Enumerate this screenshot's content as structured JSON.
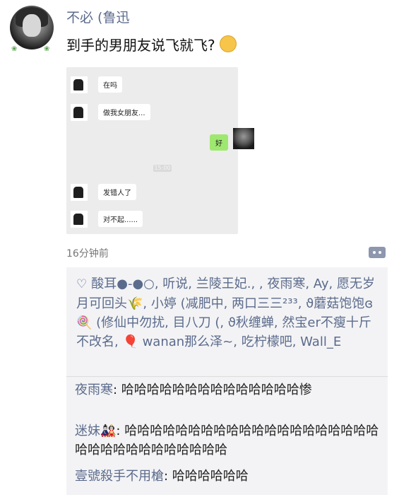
{
  "post": {
    "author": "不必 (鲁迅",
    "text": "到手的男朋友说飞就飞?",
    "emoji": "thinking-face-icon",
    "time": "16分钟前"
  },
  "chat": {
    "messages": [
      {
        "side": "left",
        "text": "在吗"
      },
      {
        "side": "left",
        "text": "做我女朋友..."
      },
      {
        "side": "right",
        "text": "好"
      },
      {
        "side": "left",
        "text": "发错人了"
      },
      {
        "side": "left",
        "text": "对不起......"
      }
    ],
    "timestamp_text": "15:00"
  },
  "likes": {
    "icon": "heart-outline-icon",
    "text": "酸耳●-●○, 听说, 兰陵王妃., , 夜雨寒, Ay, 愿无岁月可回头🌾, 小婷 (减肥中, 两口三三²³³, ϑ蘑菇饱饱ɞ🍭 (修仙中勿扰, 目八刀 (, ϑ秋缠蝉, 然宝er不瘦十斤不改名, 🎈 wanan那么泽~, 吃柠檬吧, Wall_E"
  },
  "comments": [
    {
      "who": "夜雨寒",
      "sep": ": ",
      "text": "哈哈哈哈哈哈哈哈哈哈哈哈哈哈惨"
    },
    {
      "who": "迷妹🎎",
      "sep": ": ",
      "text": "哈哈哈哈哈哈哈哈哈哈哈哈哈哈哈哈哈哈哈哈哈哈哈哈哈哈哈哈哈哈哈哈"
    },
    {
      "who": "壹號殺手不用槍",
      "sep": ": ",
      "text": "哈哈哈哈哈哈"
    }
  ],
  "colors": {
    "link": "#5b6b8c",
    "bubble_green": "#9fe870",
    "panel": "#f3f3f5"
  }
}
